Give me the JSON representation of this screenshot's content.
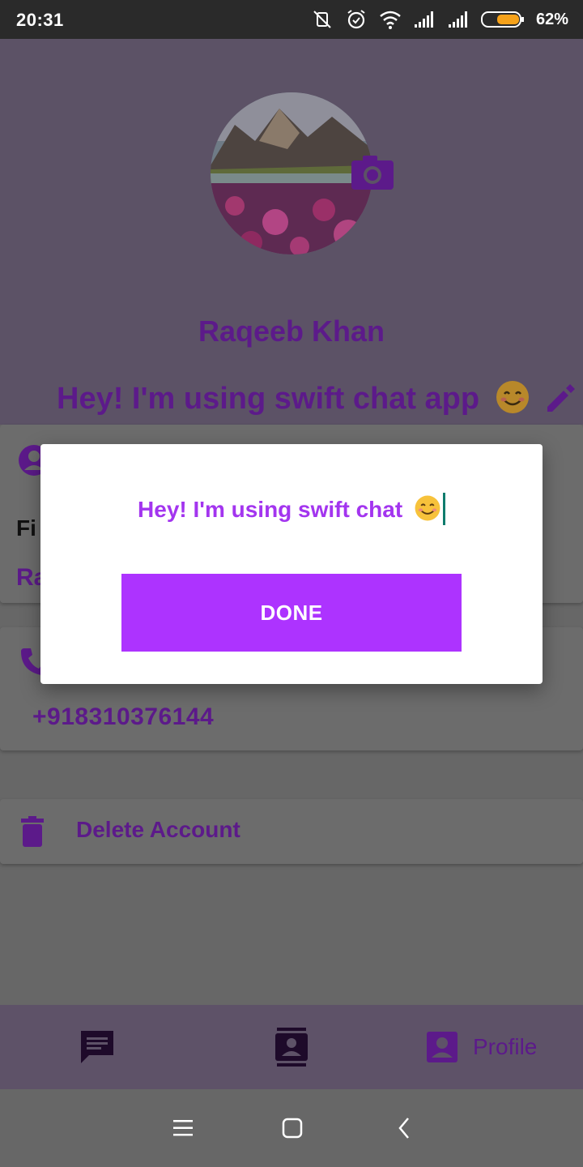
{
  "status_bar": {
    "time": "20:31",
    "battery_percent": "62%",
    "icons": [
      "mute-vibrate-icon",
      "alarm-icon",
      "wifi-icon",
      "signal-1-icon",
      "signal-2-icon",
      "battery-icon"
    ]
  },
  "profile": {
    "name": "Raqeeb Khan",
    "status": "Hey! I'm using swift chat app",
    "status_emoji": "smiling-face-icon"
  },
  "cards": {
    "name_card": {
      "label": "Fi",
      "value": "Ra"
    },
    "phone_card": {
      "value": "+918310376144"
    },
    "delete_card": {
      "label": "Delete Account"
    }
  },
  "dialog": {
    "input_value": "Hey! I'm using swift chat",
    "input_emoji": "smiling-face-icon",
    "done_label": "DONE"
  },
  "bottom_nav": {
    "items": [
      {
        "name": "chats",
        "icon": "chat-icon",
        "label": ""
      },
      {
        "name": "contacts",
        "icon": "contacts-icon",
        "label": ""
      },
      {
        "name": "profile",
        "icon": "account-box-icon",
        "label": "Profile"
      }
    ]
  },
  "colors": {
    "accent": "#ad33ff",
    "dark_purple": "#5c1a8a",
    "overlay_header": "#5c5266",
    "overlay_body": "#676767"
  }
}
